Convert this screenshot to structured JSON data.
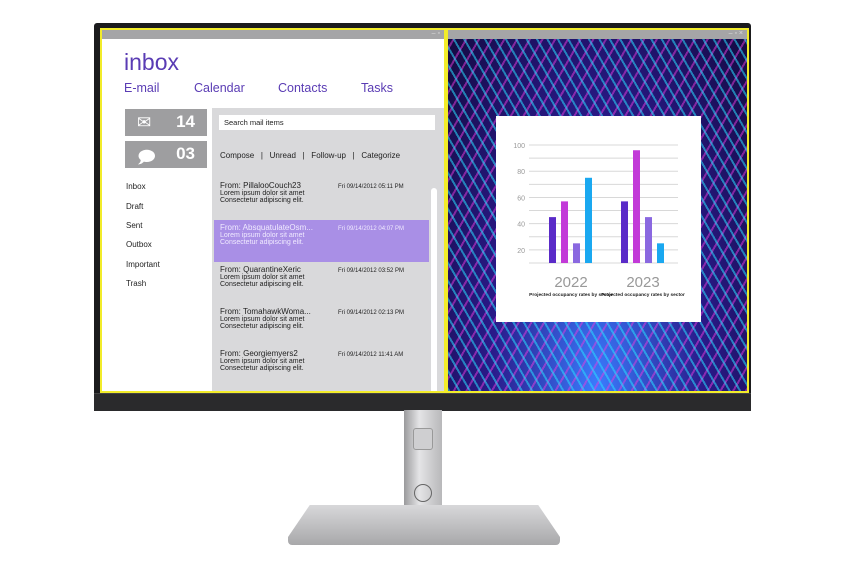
{
  "app": {
    "title": "inbox",
    "nav": [
      "E-mail",
      "Calendar",
      "Contacts",
      "Tasks"
    ]
  },
  "tiles": [
    {
      "icon": "envelope-icon",
      "count": "14"
    },
    {
      "icon": "chat-bubble-icon",
      "count": "03"
    }
  ],
  "folders": [
    "Inbox",
    "Draft",
    "Sent",
    "Outbox",
    "Important",
    "Trash"
  ],
  "search": {
    "placeholder": "Search mail items"
  },
  "toolbar": "Compose   |   Unread   |   Follow-up   |   Categorize",
  "mails": [
    {
      "from": "From: PillalooCouch23",
      "date": "Fri 09/14/2012 05:11 PM",
      "line1": "Lorem ipsum dolor sit amet",
      "line2": "Consectetur adipiscing elit.",
      "selected": false
    },
    {
      "from": "From: AbsquatulateOsm...",
      "date": "Fri 09/14/2012 04:07 PM",
      "line1": "Lorem ipsum dolor sit amet",
      "line2": "Consectetur adipiscing elit.",
      "selected": true
    },
    {
      "from": "From: QuarantineXeric",
      "date": "Fri 09/14/2012 03:52 PM",
      "line1": "Lorem ipsum dolor sit amet",
      "line2": "Consectetur adipiscing elit.",
      "selected": false
    },
    {
      "from": "From: TomahawkWoma...",
      "date": "Fri 09/14/2012 02:13 PM",
      "line1": "Lorem ipsum dolor sit amet",
      "line2": "Consectetur adipiscing elit.",
      "selected": false
    },
    {
      "from": "From: Georgiemyers2",
      "date": "Fri 09/14/2012 11:41 AM",
      "line1": "Lorem ipsum dolor sit amet",
      "line2": "Consectetur adipiscing elit.",
      "selected": false
    }
  ],
  "colors": {
    "accent": "#5a3cb4",
    "selected": "#a98fe6",
    "frame": "#f2ec2a"
  },
  "chart_data": {
    "type": "bar",
    "ylim": [
      10,
      100
    ],
    "yticks": [
      20,
      40,
      60,
      80,
      100
    ],
    "grid": true,
    "categories": [
      "2022",
      "2023"
    ],
    "category_captions": [
      "Projected occupancy rates by sector",
      "Projected occupancy rates by sector"
    ],
    "bar_colors": [
      "#5a2bc8",
      "#c23ad8",
      "#8a68e0",
      "#1aa8f0"
    ],
    "groups": [
      [
        45,
        57,
        25,
        75
      ],
      [
        57,
        96,
        45,
        25
      ]
    ]
  }
}
